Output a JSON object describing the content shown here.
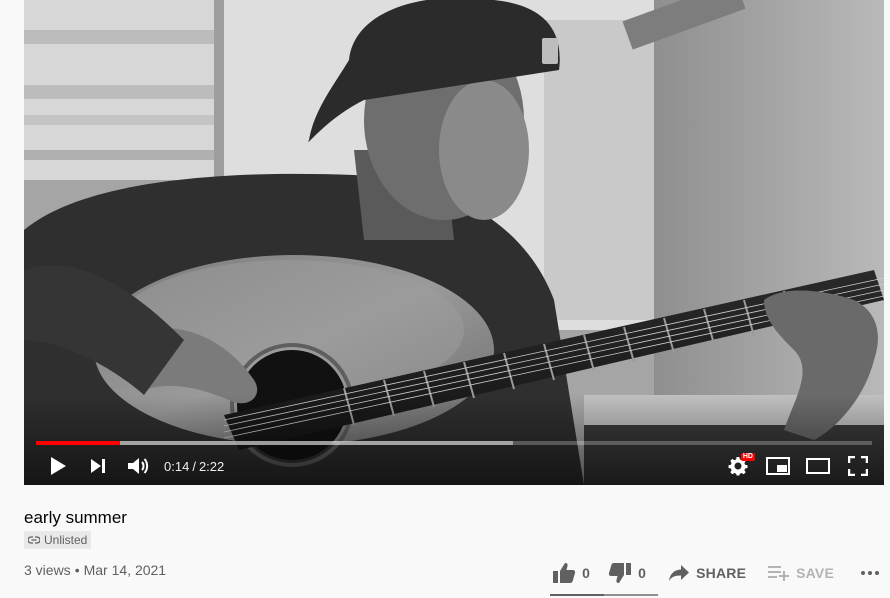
{
  "player": {
    "current_time": "0:14",
    "separator": "/",
    "duration": "2:22",
    "played_fraction": 0.1,
    "buffered_fraction": 0.57,
    "hd_badge": "HD",
    "icons": {
      "play": "play-icon",
      "next": "skip-next-icon",
      "volume": "volume-icon",
      "settings": "gear-icon",
      "miniplayer": "miniplayer-icon",
      "theater": "theater-mode-icon",
      "fullscreen": "fullscreen-icon"
    },
    "accent_color": "#ff0000"
  },
  "video": {
    "title": "early summer",
    "visibility_label": "Unlisted",
    "views": "3 views",
    "date": "Mar 14, 2021"
  },
  "actions": {
    "like_count": "0",
    "dislike_count": "0",
    "share_label": "SHARE",
    "save_label": "SAVE",
    "icons": {
      "like": "thumb-up-icon",
      "dislike": "thumb-down-icon",
      "share": "share-arrow-icon",
      "save": "playlist-add-icon",
      "more": "more-horiz-icon"
    }
  }
}
